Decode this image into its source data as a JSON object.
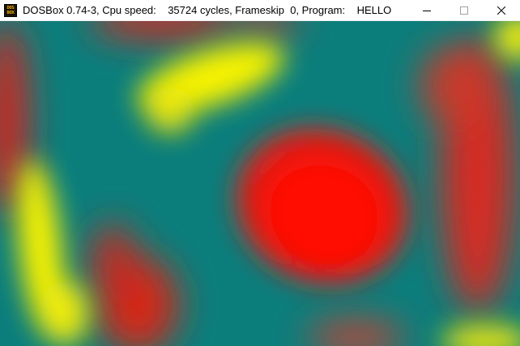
{
  "window": {
    "title": "DOSBox 0.74-3, Cpu speed:    35724 cycles, Frameskip  0, Program:    HELLO",
    "icon": {
      "name": "dosbox-icon",
      "line1": "DOS",
      "line2": "BOX"
    },
    "controls": {
      "minimize": "minimize-icon",
      "maximize": "maximize-icon",
      "close": "close-icon"
    }
  },
  "screen": {
    "description_colors": {
      "red": "#f50a05",
      "teal": "#0c7f7d",
      "yellow": "#f6f205"
    }
  }
}
